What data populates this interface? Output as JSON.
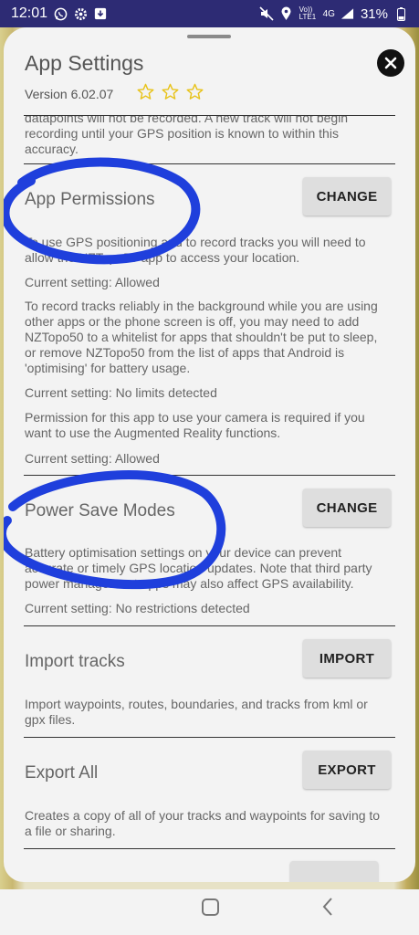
{
  "status_bar": {
    "time": "12:01",
    "left_icons": [
      "whatsapp-icon",
      "gear-icon",
      "download-icon"
    ],
    "right_icons": [
      "mute-icon",
      "location-icon",
      "volte-icon",
      "signal-icon"
    ],
    "network": "Vo)) LTE1",
    "network_type": "4G",
    "battery": "31%"
  },
  "sheet": {
    "title": "App Settings",
    "version": "Version 6.02.07",
    "star_color": "#e8c31a",
    "rating_stars": 3
  },
  "sections": {
    "accuracy_text": "datapoints will not be recorded. A new track will not begin recording until your GPS position is known to within this accuracy.",
    "permissions": {
      "title": "App Permissions",
      "button": "CHANGE",
      "p1": "To use GPS positioning and to record tracks you will need to allow the NZTopo50 app to access your location.",
      "p1_setting": "Current setting: Allowed",
      "p2": "To record tracks reliably in the background while you are using other apps or the phone screen is off, you may need to add NZTopo50 to a whitelist for apps that shouldn't be put to sleep, or remove NZTopo50 from the list of apps that Android is 'optimising' for battery usage.",
      "p2_setting": "Current setting: No limits detected",
      "p3": "Permission for this app to use your camera is required if you want to use the Augmented Reality functions.",
      "p3_setting": "Current setting: Allowed"
    },
    "power": {
      "title": "Power Save Modes",
      "button": "CHANGE",
      "text": "Battery optimisation settings on your device can prevent accurate or timely GPS location updates. Note that third party power management apps may also affect GPS availability.",
      "setting": "Current setting: No restrictions detected"
    },
    "import": {
      "title": "Import tracks",
      "button": "IMPORT",
      "text": "Import waypoints, routes, boundaries, and tracks from kml or gpx files."
    },
    "export": {
      "title": "Export All",
      "button": "EXPORT",
      "text": "Creates a copy of all of your tracks and waypoints for saving to a file or sharing."
    }
  },
  "annotation_color": "#1f3fdc",
  "nav_bar": {
    "home": "home-button",
    "back": "back-button"
  }
}
